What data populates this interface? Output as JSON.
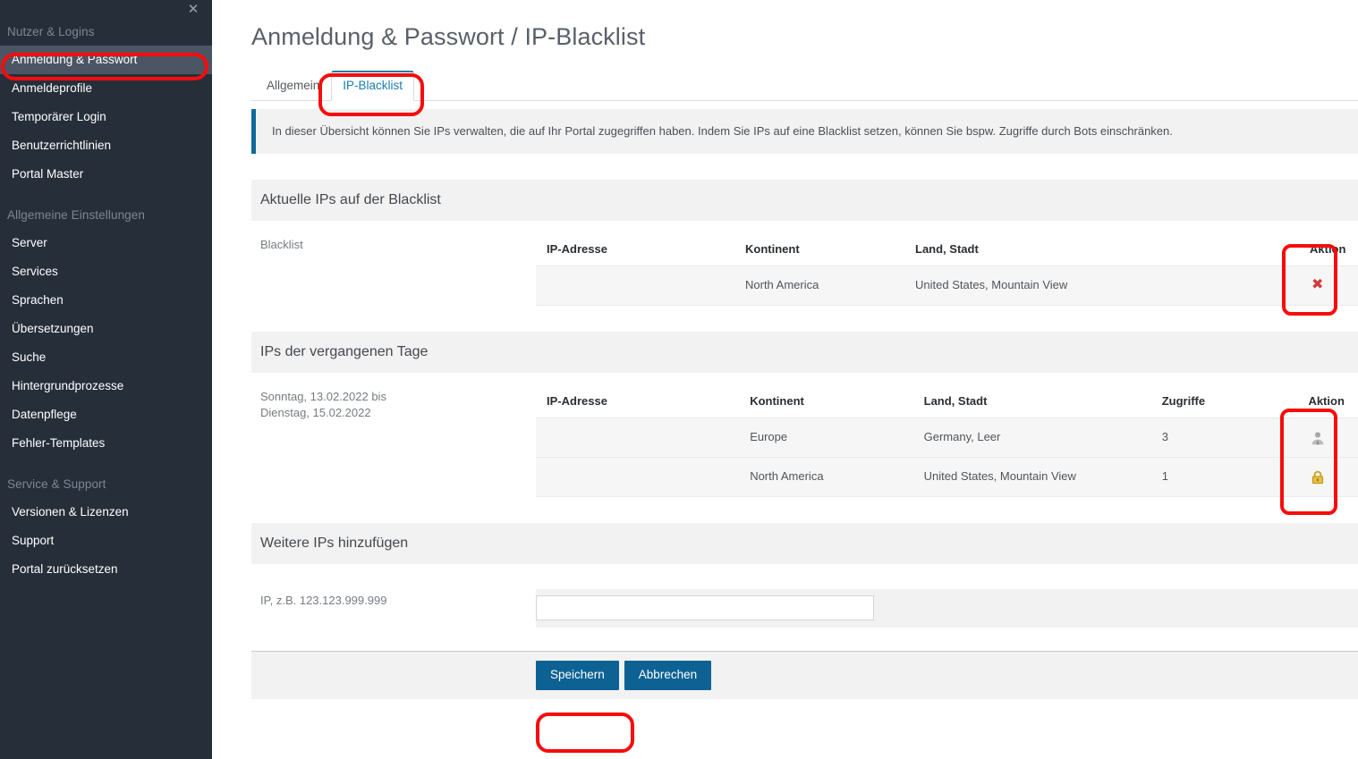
{
  "sidebar": {
    "close_icon": "close-icon",
    "groups": [
      {
        "title": "Nutzer & Logins",
        "items": [
          {
            "label": "Anmeldung & Passwort",
            "active": true
          },
          {
            "label": "Anmeldeprofile",
            "active": false
          },
          {
            "label": "Temporärer Login",
            "active": false
          },
          {
            "label": "Benutzerrichtlinien",
            "active": false
          },
          {
            "label": "Portal Master",
            "active": false
          }
        ]
      },
      {
        "title": "Allgemeine Einstellungen",
        "items": [
          {
            "label": "Server",
            "active": false
          },
          {
            "label": "Services",
            "active": false
          },
          {
            "label": "Sprachen",
            "active": false
          },
          {
            "label": "Übersetzungen",
            "active": false
          },
          {
            "label": "Suche",
            "active": false
          },
          {
            "label": "Hintergrundprozesse",
            "active": false
          },
          {
            "label": "Datenpflege",
            "active": false
          },
          {
            "label": "Fehler-Templates",
            "active": false
          }
        ]
      },
      {
        "title": "Service & Support",
        "items": [
          {
            "label": "Versionen & Lizenzen",
            "active": false
          },
          {
            "label": "Support",
            "active": false
          },
          {
            "label": "Portal zurücksetzen",
            "active": false
          }
        ]
      }
    ]
  },
  "page": {
    "title": "Anmeldung & Passwort / IP-Blacklist"
  },
  "tabs": [
    {
      "label": "Allgemein",
      "active": false
    },
    {
      "label": "IP-Blacklist",
      "active": true
    }
  ],
  "info_banner": {
    "text": "In dieser Übersicht können Sie IPs verwalten, die auf Ihr Portal zugegriffen haben. Indem Sie IPs auf eine Blacklist setzen, können Sie bspw. Zugriffe durch Bots einschränken.",
    "accent_color": "#0d6a9b"
  },
  "section_current": {
    "heading": "Aktuelle IPs auf der Blacklist",
    "row_label": "Blacklist",
    "columns": [
      "IP-Adresse",
      "Kontinent",
      "Land, Stadt",
      "Aktion"
    ],
    "rows": [
      {
        "ip": "",
        "kontinent": "North America",
        "land_stadt": "United States, Mountain View",
        "action_icon": "delete-x-icon"
      }
    ]
  },
  "section_recent": {
    "heading": "IPs der vergangenen Tage",
    "row_label": "Sonntag, 13.02.2022 bis\nDienstag, 15.02.2022",
    "row_label_line1": "Sonntag, 13.02.2022 bis",
    "row_label_line2": "Dienstag, 15.02.2022",
    "columns": [
      "IP-Adresse",
      "Kontinent",
      "Land, Stadt",
      "Zugriffe",
      "Aktion"
    ],
    "rows": [
      {
        "ip": "",
        "kontinent": "Europe",
        "land_stadt": "Germany, Leer",
        "zugriffe": "3",
        "action_icon": "user-icon"
      },
      {
        "ip": "",
        "kontinent": "North America",
        "land_stadt": "United States, Mountain View",
        "zugriffe": "1",
        "action_icon": "lock-icon"
      }
    ]
  },
  "section_add": {
    "heading": "Weitere IPs hinzufügen",
    "field_label": "IP, z.B. 123.123.999.999",
    "field_value": "",
    "field_placeholder": ""
  },
  "footer": {
    "save_label": "Speichern",
    "cancel_label": "Abbrechen",
    "button_color": "#0d6293"
  },
  "annotations": {
    "highlight_color": "#f60c0c",
    "items": [
      "sidebar-item-anmeldung-passwort",
      "tab-ip-blacklist",
      "aktion-column-current",
      "aktion-column-recent",
      "save-button"
    ]
  }
}
